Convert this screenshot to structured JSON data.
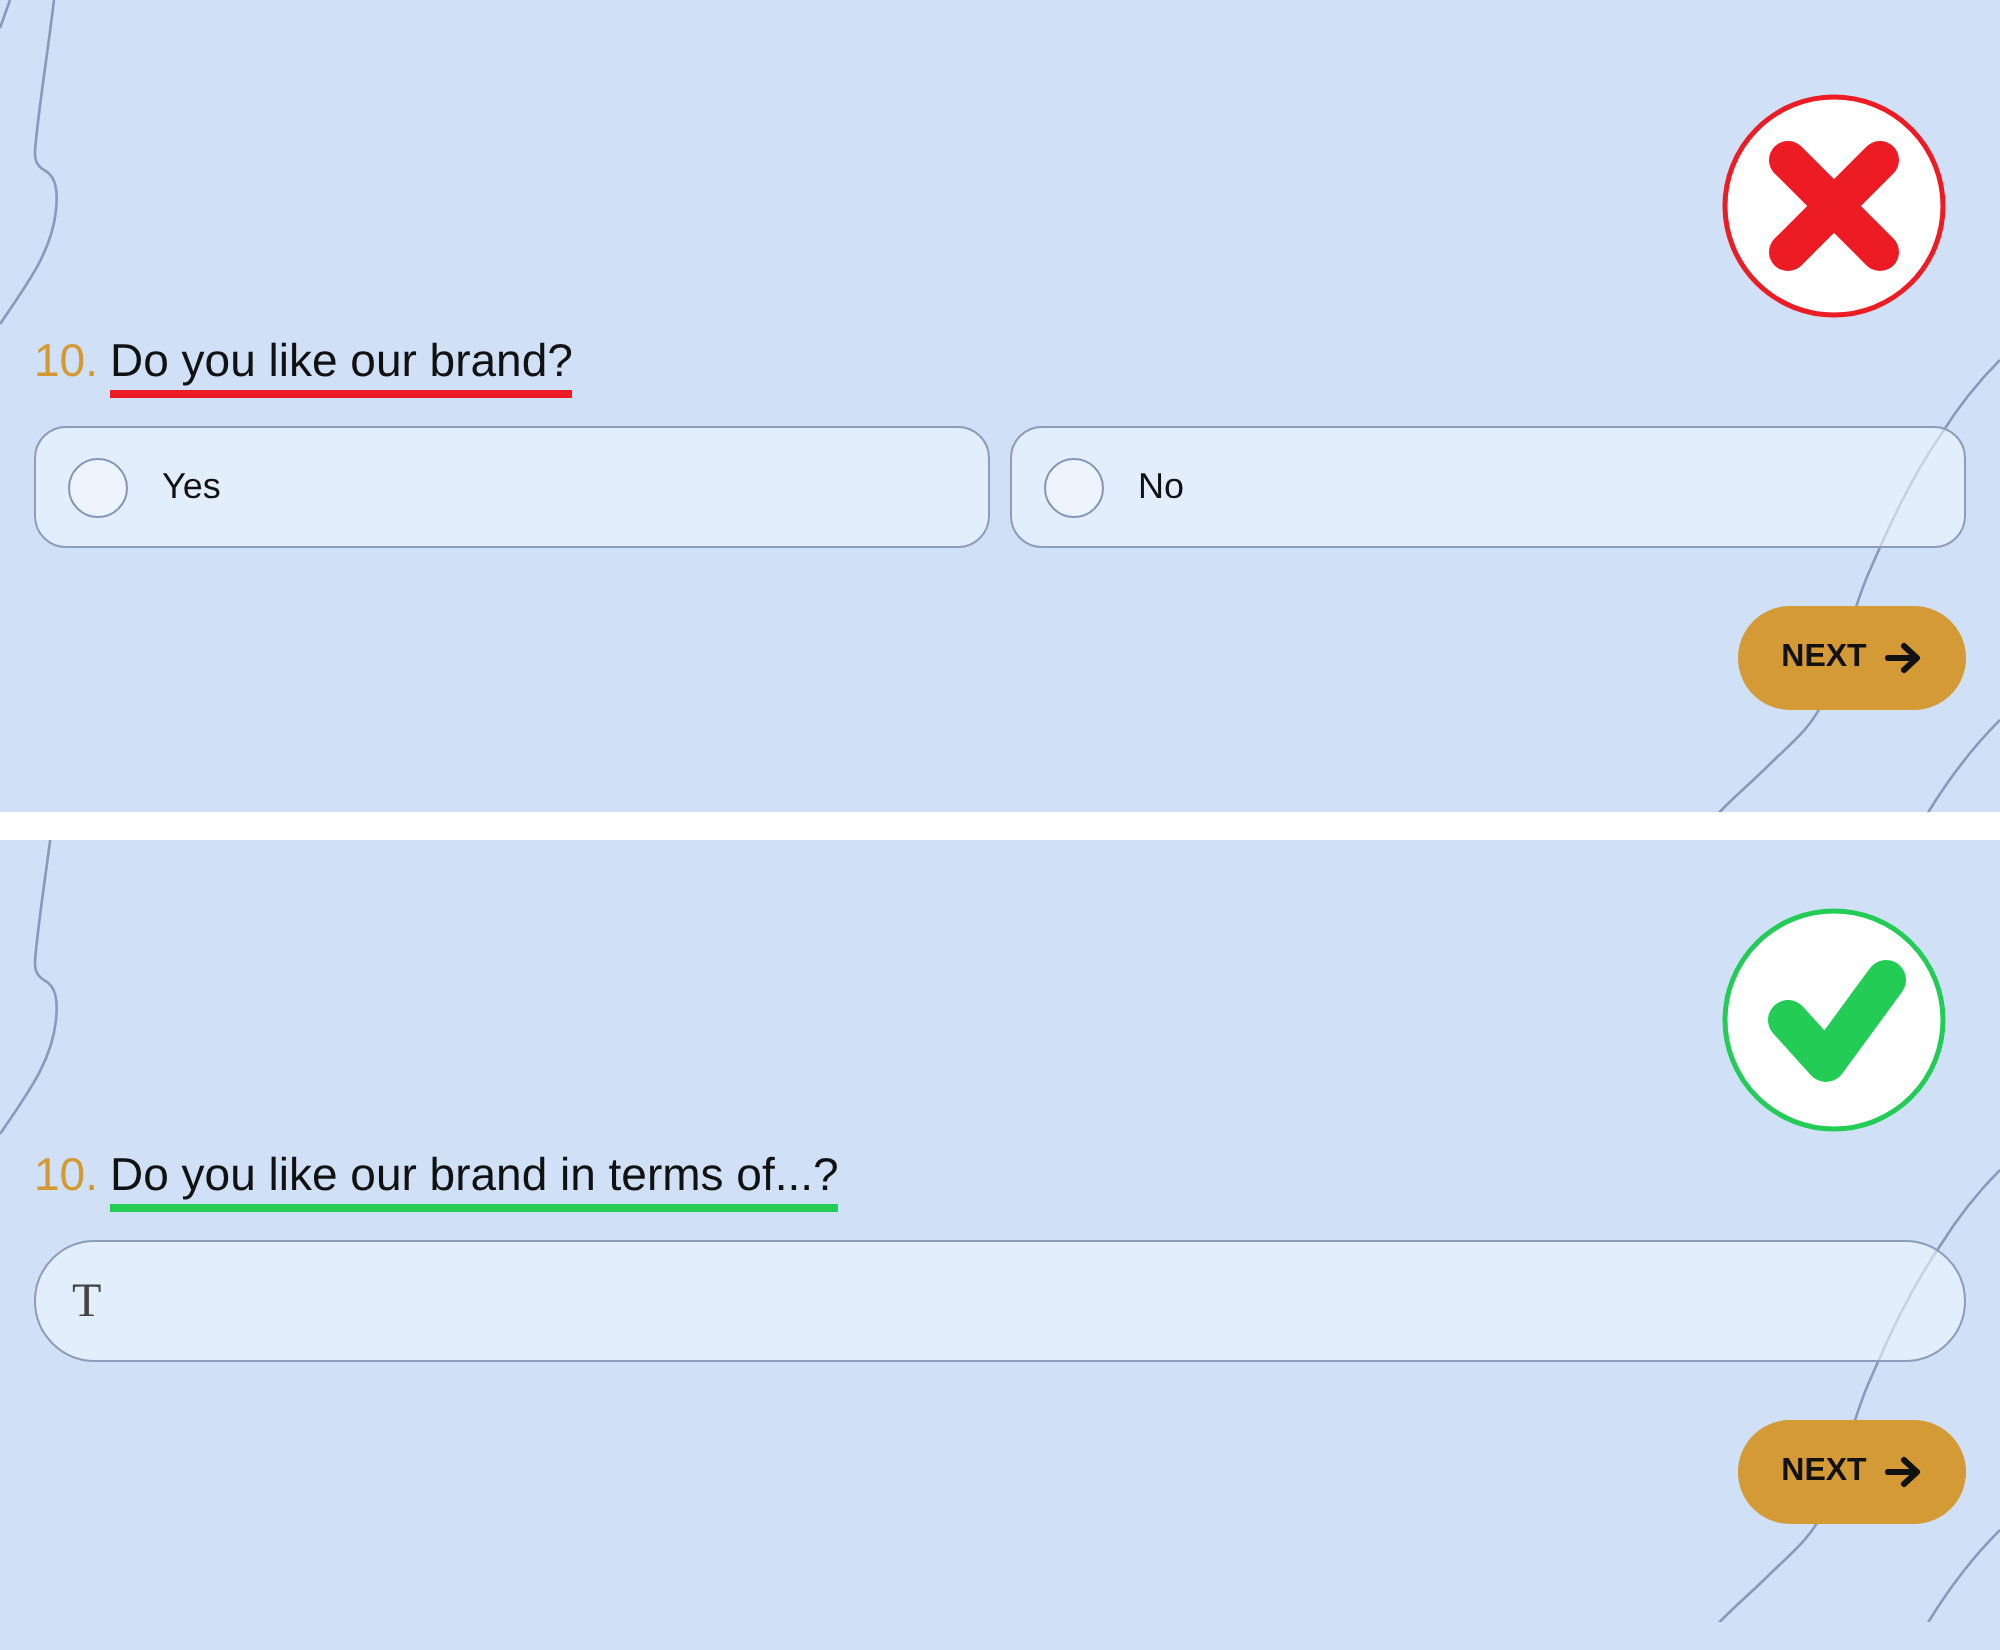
{
  "questions": [
    {
      "number": "10.",
      "text": "Do you like our brand?",
      "correct": false,
      "answer": {
        "kind": "choice",
        "options": [
          {
            "label": "Yes",
            "selected": false
          },
          {
            "label": "No",
            "selected": false
          }
        ]
      },
      "next_button": "NEXT"
    },
    {
      "number": "10.",
      "text": "Do you like our brand in terms of...?",
      "correct": true,
      "answer": {
        "kind": "text",
        "field_glyph": "T"
      },
      "next_button": "NEXT"
    }
  ]
}
